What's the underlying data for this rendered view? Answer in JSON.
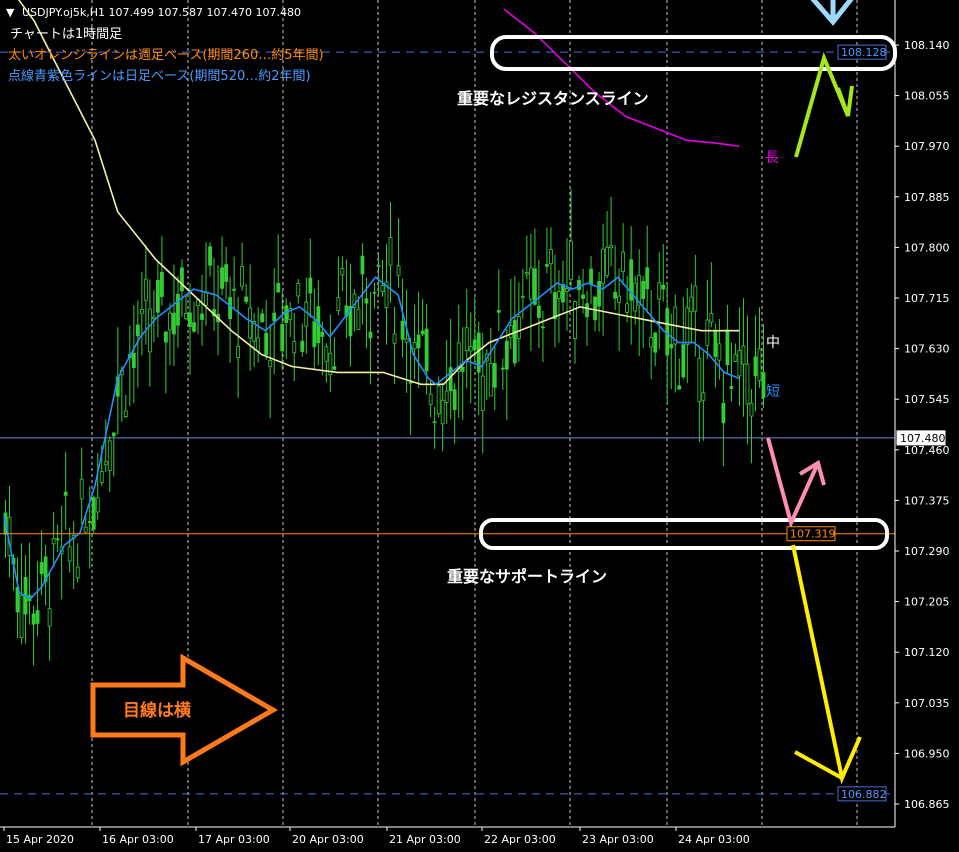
{
  "header": {
    "symbol_line": "USDJPY.oj5k,H1  107.499 107.587 107.470 107.480",
    "note_1": "チャートは1時間足",
    "note_2": "太いオレンジラインは週足ベース(期間260…約5年間)",
    "note_3": "点線青紫色ラインは日足ベース(期間520…約2年間)"
  },
  "colors": {
    "background": "#000000",
    "candle": "#32cd32",
    "ma_short": "#1e90ff",
    "ma_mid": "#f5f0a0",
    "ma_long": "#e100e1",
    "weekly_line": "#ff8c00",
    "daily_line": "#4169e1"
  },
  "annotations": {
    "resistance_label": "重要なレジスタンスライン",
    "support_label": "重要なサポートライン",
    "arrow_label": "目線は横",
    "ma_long_label": "長",
    "ma_mid_label": "中",
    "ma_short_label": "短"
  },
  "price_tags": {
    "resistance": "108.128",
    "current": "107.480",
    "support": "107.319",
    "daily_low": "106.882"
  },
  "chart_data": {
    "type": "candlestick",
    "title": "USDJPY.oj5k,H1",
    "ohlc_last": {
      "open": 107.499,
      "high": 107.587,
      "low": 107.47,
      "close": 107.48
    },
    "y_ticks": [
      "108.140",
      "108.055",
      "107.970",
      "107.885",
      "107.800",
      "107.715",
      "107.630",
      "107.545",
      "107.460",
      "107.375",
      "107.290",
      "107.205",
      "107.120",
      "107.035",
      "106.950",
      "106.865"
    ],
    "x_ticks": [
      "15 Apr 2020",
      "16 Apr 03:00",
      "17 Apr 03:00",
      "20 Apr 03:00",
      "21 Apr 03:00",
      "22 Apr 03:00",
      "23 Apr 03:00",
      "24 Apr 03:00"
    ],
    "ylim": [
      106.83,
      108.2
    ],
    "horizontal_lines": [
      {
        "price": 108.128,
        "style": "dashed"
      },
      {
        "price": 107.48,
        "style": "solid"
      },
      {
        "price": 107.319,
        "style": "solid"
      },
      {
        "price": 106.882,
        "style": "dashed"
      }
    ],
    "ma_short": [
      [
        0,
        107.35
      ],
      [
        0.02,
        107.22
      ],
      [
        0.035,
        107.21
      ],
      [
        0.05,
        107.23
      ],
      [
        0.08,
        107.3
      ],
      [
        0.1,
        107.32
      ],
      [
        0.12,
        107.4
      ],
      [
        0.15,
        107.58
      ],
      [
        0.18,
        107.65
      ],
      [
        0.2,
        107.68
      ],
      [
        0.23,
        107.71
      ],
      [
        0.25,
        107.73
      ],
      [
        0.28,
        107.72
      ],
      [
        0.3,
        107.7
      ],
      [
        0.32,
        107.68
      ],
      [
        0.345,
        107.66
      ],
      [
        0.37,
        107.69
      ],
      [
        0.39,
        107.7
      ],
      [
        0.41,
        107.68
      ],
      [
        0.43,
        107.65
      ],
      [
        0.46,
        107.7
      ],
      [
        0.49,
        107.75
      ],
      [
        0.52,
        107.72
      ],
      [
        0.54,
        107.62
      ],
      [
        0.56,
        107.58
      ],
      [
        0.57,
        107.57
      ],
      [
        0.59,
        107.59
      ],
      [
        0.61,
        107.61
      ],
      [
        0.63,
        107.6
      ],
      [
        0.65,
        107.64
      ],
      [
        0.67,
        107.68
      ],
      [
        0.7,
        107.71
      ],
      [
        0.73,
        107.74
      ],
      [
        0.75,
        107.73
      ],
      [
        0.77,
        107.74
      ],
      [
        0.79,
        107.73
      ],
      [
        0.81,
        107.75
      ],
      [
        0.83,
        107.72
      ],
      [
        0.85,
        107.69
      ],
      [
        0.87,
        107.66
      ],
      [
        0.89,
        107.64
      ],
      [
        0.91,
        107.64
      ],
      [
        0.93,
        107.62
      ],
      [
        0.95,
        107.59
      ],
      [
        0.97,
        107.58
      ]
    ],
    "ma_mid": [
      [
        0,
        108.25
      ],
      [
        0.04,
        108.18
      ],
      [
        0.08,
        108.08
      ],
      [
        0.12,
        107.98
      ],
      [
        0.15,
        107.86
      ],
      [
        0.2,
        107.78
      ],
      [
        0.25,
        107.72
      ],
      [
        0.3,
        107.66
      ],
      [
        0.34,
        107.62
      ],
      [
        0.38,
        107.6
      ],
      [
        0.44,
        107.59
      ],
      [
        0.5,
        107.59
      ],
      [
        0.55,
        107.57
      ],
      [
        0.58,
        107.57
      ],
      [
        0.61,
        107.61
      ],
      [
        0.64,
        107.64
      ],
      [
        0.68,
        107.66
      ],
      [
        0.72,
        107.68
      ],
      [
        0.76,
        107.7
      ],
      [
        0.8,
        107.69
      ],
      [
        0.84,
        107.68
      ],
      [
        0.88,
        107.67
      ],
      [
        0.92,
        107.66
      ],
      [
        0.97,
        107.66
      ]
    ],
    "ma_long": [
      [
        0.66,
        108.2
      ],
      [
        0.7,
        108.16
      ],
      [
        0.74,
        108.11
      ],
      [
        0.78,
        108.06
      ],
      [
        0.82,
        108.02
      ],
      [
        0.86,
        108.0
      ],
      [
        0.9,
        107.98
      ],
      [
        0.94,
        107.975
      ],
      [
        0.97,
        107.97
      ]
    ]
  }
}
